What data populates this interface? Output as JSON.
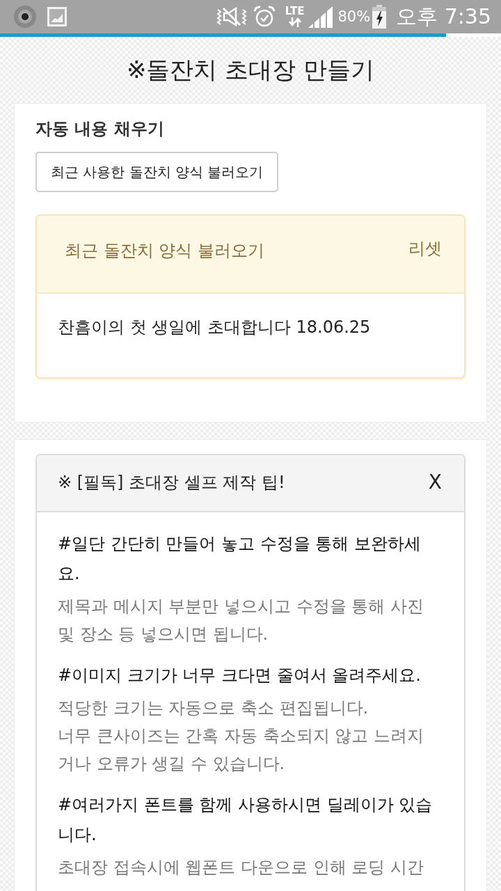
{
  "status_bar": {
    "network": "LTE",
    "battery": "80%",
    "charging": true,
    "time": "오후 7:35"
  },
  "loading_bar": {
    "level": 0.89
  },
  "page_title": "※돌잔치 초대장 만들기",
  "autofill": {
    "heading": "자동 내용 채우기",
    "load_button": "최근 사용한 돌잔치 양식 불러오기",
    "recent_panel": {
      "title": "최근 돌잔치 양식 불러오기",
      "reset": "리셋",
      "items": [
        "찬흠이의 첫 생일에 초대합니다 18.06.25"
      ]
    }
  },
  "tips_panel": {
    "title": "※ [필독] 초대장 셀프 제작 팁!",
    "close": "X",
    "tips": [
      {
        "heading": "#일단 간단히 만들어 놓고 수정을 통해 보완하세요.",
        "details": [
          "제목과 메시지 부분만 넣으시고 수정을 통해 사진 및 장소 등 넣으시면 됩니다."
        ]
      },
      {
        "heading": "#이미지 크기가 너무 크다면 줄여서 올려주세요.",
        "details": [
          "적당한 크기는 자동으로 축소 편집됩니다.",
          "너무 큰사이즈는 간혹 자동 축소되지 않고 느려지거나 오류가 생길 수 있습니다."
        ]
      },
      {
        "heading": "#여러가지 폰트를 함께 사용하시면 딜레이가 있습니다.",
        "details": [
          "초대장 접속시에 웹폰트 다운으로 인해 로딩 시간"
        ]
      }
    ]
  }
}
